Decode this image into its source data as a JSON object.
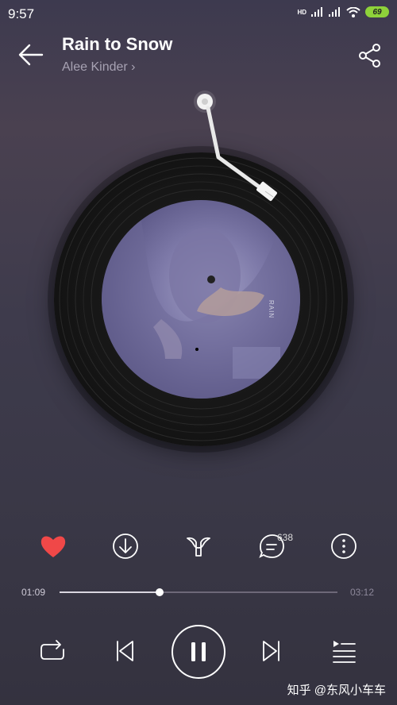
{
  "status_bar": {
    "time": "9:57",
    "network": "HD",
    "battery": "69"
  },
  "header": {
    "title": "Rain to Snow",
    "artist": "Alee Kinder",
    "artist_chevron": "›"
  },
  "album": {
    "cover_text": "RAIN"
  },
  "actions": {
    "liked": true,
    "like_color": "#f04848",
    "comment_count": "638"
  },
  "playback": {
    "elapsed": "01:09",
    "total": "03:12",
    "progress": 0.36
  },
  "watermark": "知乎 @东风小车车",
  "icons": {
    "back": "arrow-left-icon",
    "share": "share-icon",
    "like": "heart-icon",
    "download": "download-icon",
    "tone": "sound-effect-icon",
    "comment": "comment-icon",
    "more": "more-icon",
    "repeat": "repeat-icon",
    "prev": "previous-icon",
    "play": "pause-icon",
    "next": "next-icon",
    "playlist": "playlist-icon"
  }
}
